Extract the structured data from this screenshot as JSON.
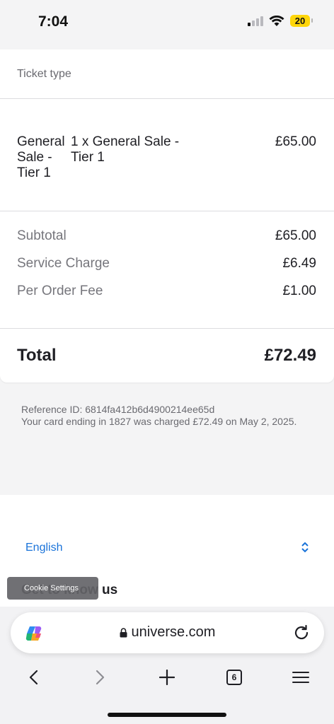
{
  "status_bar": {
    "time": "7:04",
    "battery": "20"
  },
  "order": {
    "ticket_type_label": "Ticket type",
    "item": {
      "name": "General Sale - Tier 1",
      "description": "1 x General Sale - Tier 1",
      "price": "£65.00"
    },
    "summary": [
      {
        "label": "Subtotal",
        "value": "£65.00"
      },
      {
        "label": "Service Charge",
        "value": "£6.49"
      },
      {
        "label": "Per Order Fee",
        "value": "£1.00"
      }
    ],
    "total_label": "Total",
    "total_value": "£72.49"
  },
  "reference": {
    "id_line": "Reference ID: 6814fa412b6d4900214ee65d",
    "charge_line": "Your card ending in 1827 was charged £72.49 on May 2, 2025."
  },
  "footer": {
    "language": "English",
    "heading": "Get to know us",
    "cookie_button": "Cookie Settings"
  },
  "browser": {
    "url": "universe.com",
    "tab_count": "6"
  },
  "colors": {
    "link": "#1a73d9",
    "battery": "#ffd60a"
  }
}
